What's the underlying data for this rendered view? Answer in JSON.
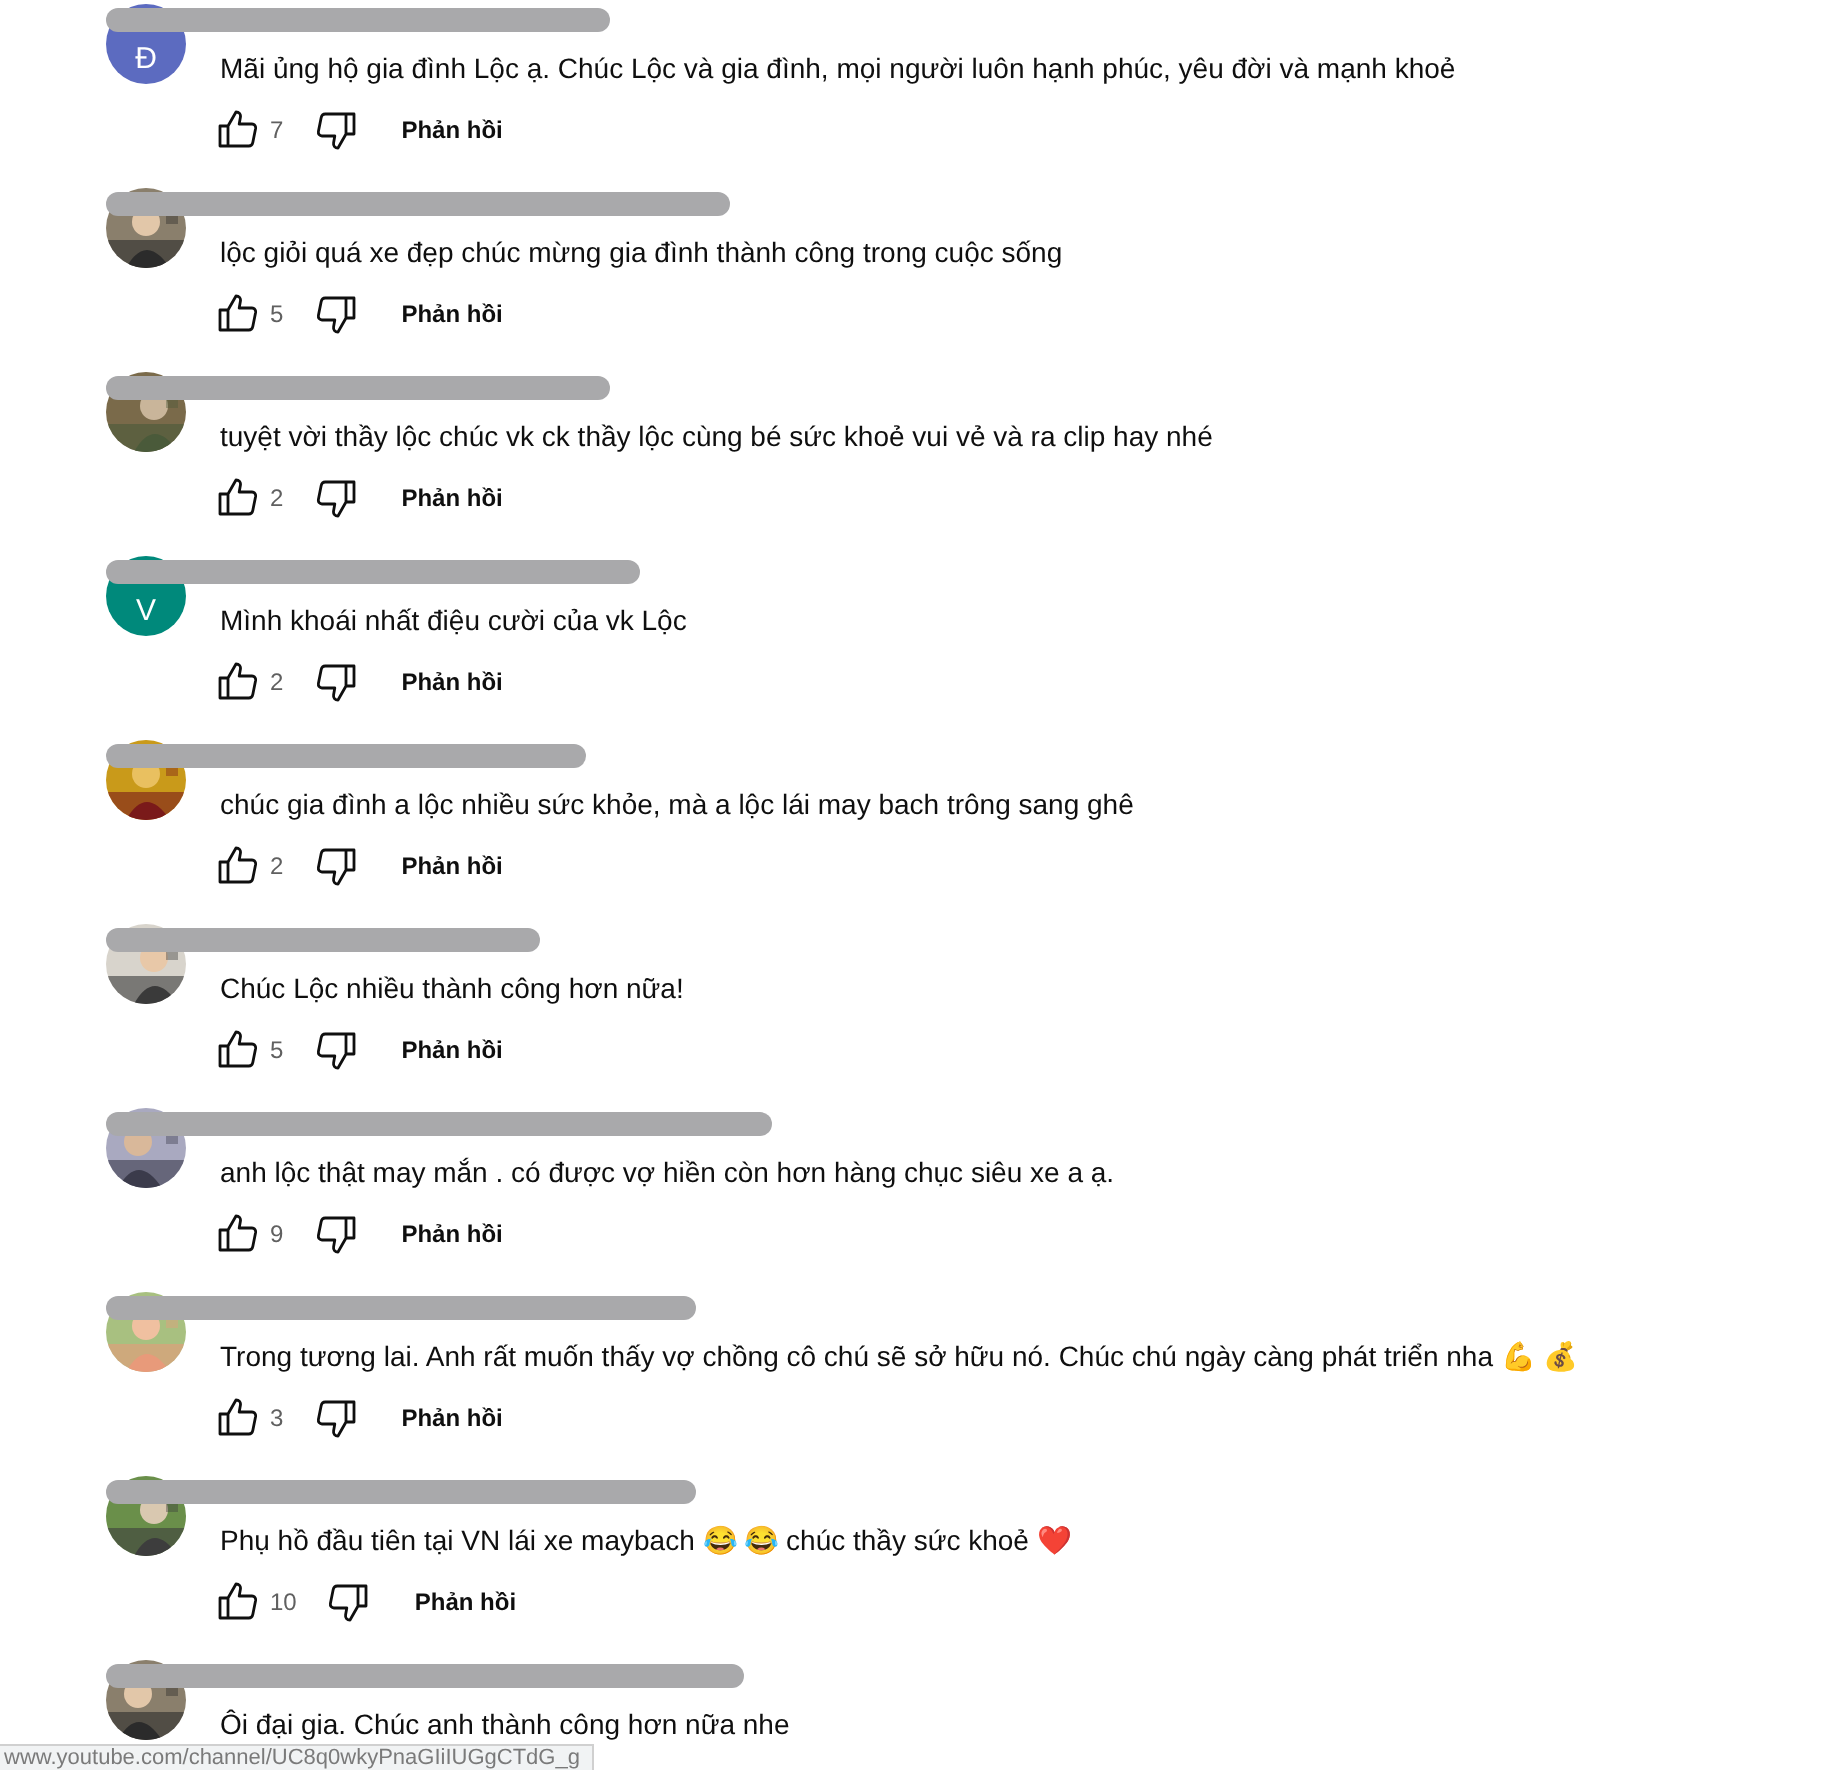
{
  "comments": [
    {
      "avatar": {
        "kind": "letter",
        "letter": "Đ",
        "color": "#5c6bc0"
      },
      "name_redacted": true,
      "text": "Mãi ủng hộ gia đình Lộc ạ. Chúc Lộc và gia đình, mọi người luôn hạnh phúc, yêu đời và mạnh khoẻ",
      "likes": "7",
      "reply": "Phản hồi"
    },
    {
      "name_redacted": true,
      "text": "lộc  giỏi quá  xe đẹp chúc mừng gia đình thành công trong cuộc sống",
      "likes": "5",
      "reply": "Phản hồi"
    },
    {
      "name_redacted": true,
      "text": "tuyệt vời thầy lộc chúc vk ck thầy lộc cùng bé sức khoẻ vui vẻ và ra clip hay nhé",
      "likes": "2",
      "reply": "Phản hồi"
    },
    {
      "avatar": {
        "kind": "letter",
        "letter": "V",
        "color": "#00897b"
      },
      "name_redacted": true,
      "text": "Mình khoái nhất điệu cười của vk Lộc",
      "likes": "2",
      "reply": "Phản hồi"
    },
    {
      "name_redacted": true,
      "text": "chúc gia đình a lộc nhiều sức khỏe, mà a lộc lái may bach trông sang ghê",
      "likes": "2",
      "reply": "Phản hồi"
    },
    {
      "name_redacted": true,
      "text": "Chúc Lộc nhiều thành công hơn nữa!",
      "likes": "5",
      "reply": "Phản hồi"
    },
    {
      "name_redacted": true,
      "text": "anh lộc thật may mắn . có được vợ hiền còn hơn hàng chục siêu xe a ạ.",
      "likes": "9",
      "reply": "Phản hồi"
    },
    {
      "name_redacted": true,
      "text": "Trong tương lai. Anh rất muốn thấy vợ chồng cô chú sẽ sở hữu nó. Chúc chú ngày càng phát triển nha 💪 💰",
      "likes": "3",
      "reply": "Phản hồi"
    },
    {
      "name_redacted": true,
      "text": "Phụ hồ đầu tiên tại VN lái xe maybach 😂 😂 chúc thầy sức khoẻ ❤️",
      "likes": "10",
      "reply": "Phản hồi"
    },
    {
      "name_redacted": true,
      "text": "Ôi đại gia. Chúc anh thành công hơn nữa nhe"
    }
  ],
  "status_bar": {
    "url": "www.youtube.com/channel/UC8q0wkyPnaGIiIUGgCTdG_g"
  }
}
